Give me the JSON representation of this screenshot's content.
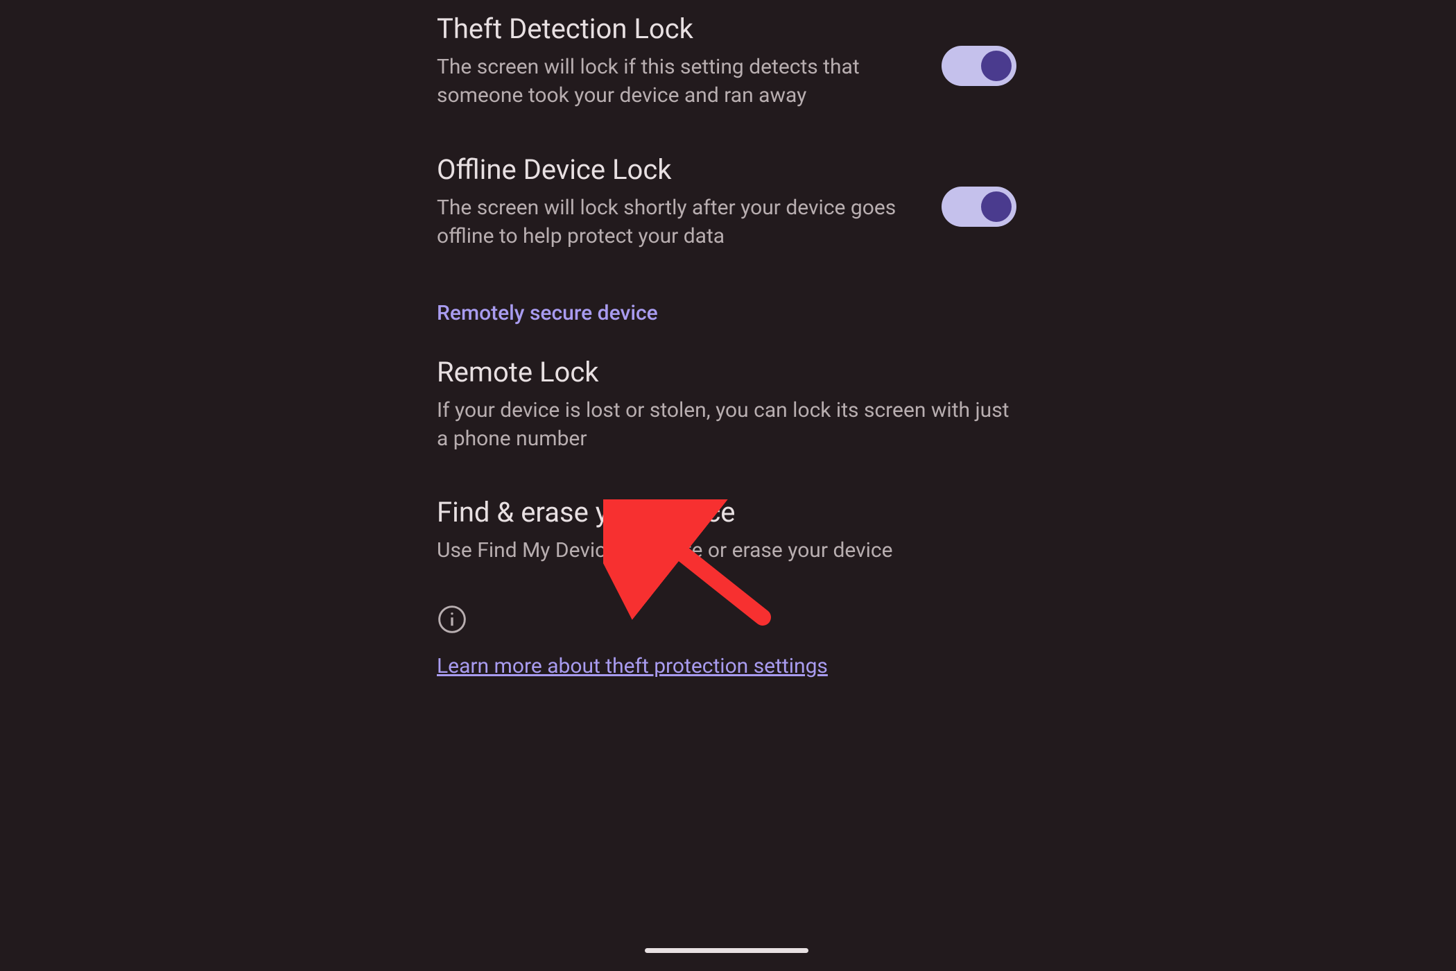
{
  "settings": {
    "theftDetection": {
      "title": "Theft Detection Lock",
      "description": "The screen will lock if this setting detects that someone took your device and ran away",
      "enabled": true
    },
    "offlineLock": {
      "title": "Offline Device Lock",
      "description": "The screen will lock shortly after your device goes offline to help protect your data",
      "enabled": true
    }
  },
  "sectionHeader": "Remotely secure device",
  "remoteLock": {
    "title": "Remote Lock",
    "description": "If your device is lost or stolen, you can lock its screen with just a phone number"
  },
  "findErase": {
    "title": "Find & erase your device",
    "description": "Use Find My Device to locate or erase your device"
  },
  "learnMoreText": "Learn more about theft protection settings",
  "colors": {
    "background": "#221a1d",
    "titleText": "#e8e0e2",
    "descriptionText": "#b8aeb0",
    "accent": "#a99cf0",
    "toggleTrack": "#c5c1ec",
    "toggleThumb": "#4a3b8e",
    "arrowRed": "#f73030"
  }
}
